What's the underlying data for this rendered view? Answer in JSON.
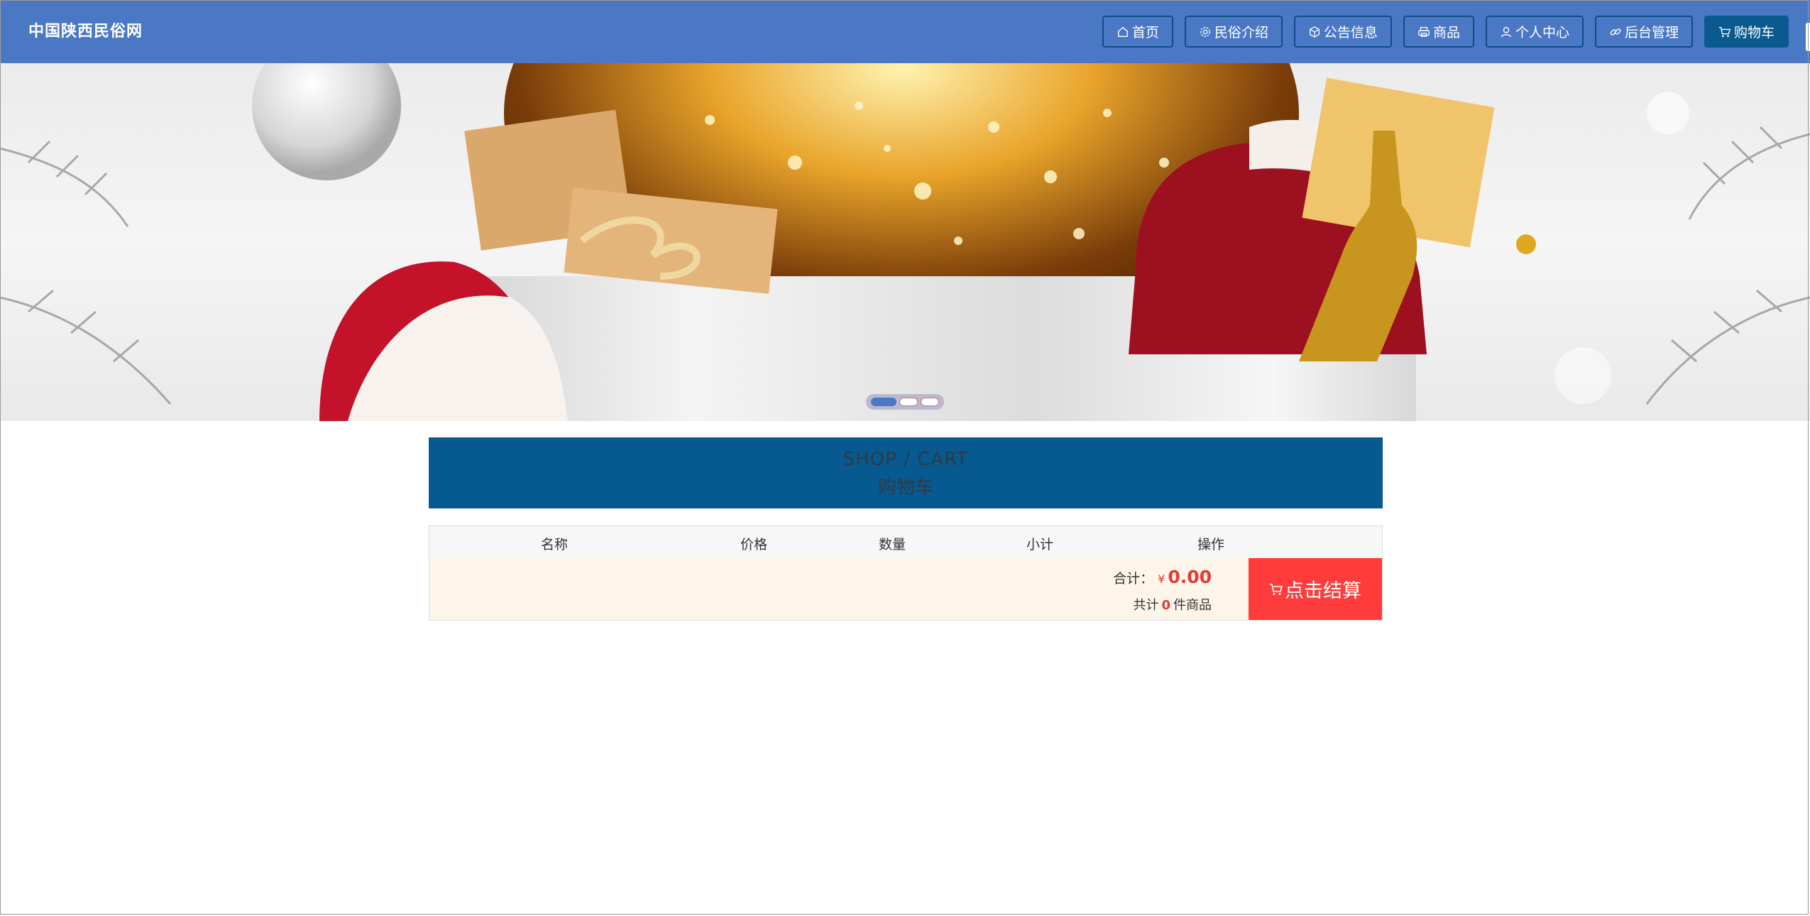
{
  "nav": {
    "brand": "中国陕西民俗网",
    "items": [
      {
        "label": "首页",
        "icon": "home-icon"
      },
      {
        "label": "民俗介绍",
        "icon": "gear-icon"
      },
      {
        "label": "公告信息",
        "icon": "box-icon"
      },
      {
        "label": "商品",
        "icon": "print-icon"
      },
      {
        "label": "个人中心",
        "icon": "user-icon"
      },
      {
        "label": "后台管理",
        "icon": "link-icon"
      },
      {
        "label": "购物车",
        "icon": "cart-icon",
        "active": true
      }
    ]
  },
  "banner": {
    "slides": 3,
    "active_slide": 1
  },
  "section": {
    "title_en": "SHOP / CART",
    "title_cn": "购物车"
  },
  "cart": {
    "headers": [
      "名称",
      "价格",
      "数量",
      "小计",
      "操作"
    ],
    "total_label": "合计：",
    "currency": "¥",
    "total_amount": "0.00",
    "count_prefix": "共计",
    "count": "0",
    "count_suffix": "件商品",
    "checkout_label": "点击结算"
  },
  "colors": {
    "nav_bg": "#4a78c4",
    "section_bg": "#065a8f",
    "checkout_bg": "#ff3b3b",
    "price_red": "#e53935",
    "cart_footer_bg": "#fdf5e9"
  }
}
